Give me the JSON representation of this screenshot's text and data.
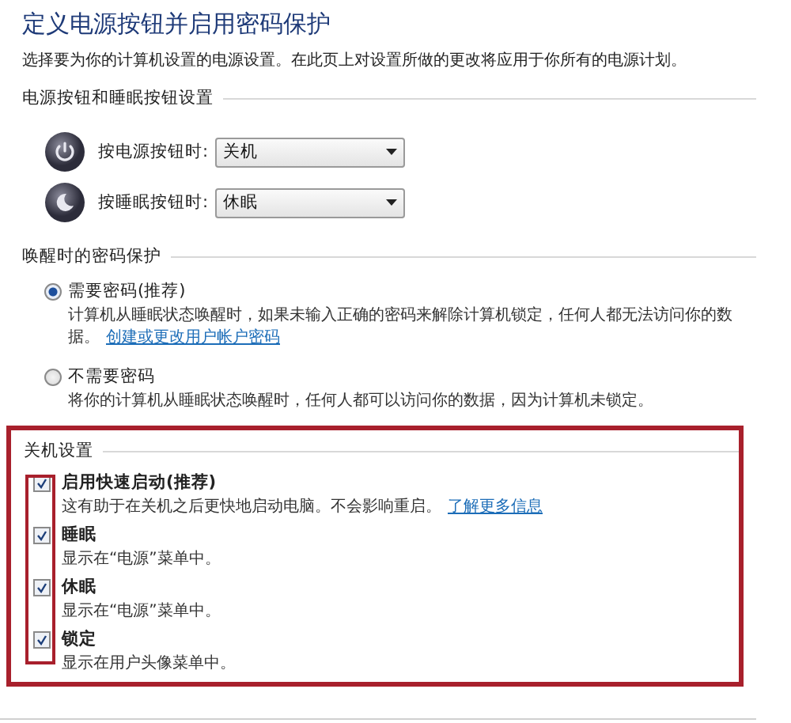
{
  "title": "定义电源按钮并启用密码保护",
  "description": "选择要为你的计算机设置的电源设置。在此页上对设置所做的更改将应用于你所有的电源计划。",
  "button_section": {
    "heading": "电源按钮和睡眠按钮设置",
    "rows": [
      {
        "kind": "power",
        "label": "按电源按钮时:",
        "value": "关机"
      },
      {
        "kind": "sleep",
        "label": "按睡眠按钮时:",
        "value": "休眠"
      }
    ]
  },
  "password_section": {
    "heading": "唤醒时的密码保护",
    "options": [
      {
        "label": "需要密码(推荐)",
        "description": "计算机从睡眠状态唤醒时，如果未输入正确的密码来解除计算机锁定，任何人都无法访问你的数据。",
        "link": "创建或更改用户帐户密码",
        "selected": true
      },
      {
        "label": "不需要密码",
        "description": "将你的计算机从睡眠状态唤醒时，任何人都可以访问你的数据，因为计算机未锁定。",
        "selected": false
      }
    ]
  },
  "shutdown_section": {
    "heading": "关机设置",
    "items": [
      {
        "label": "启用快速启动(推荐)",
        "description": "这有助于在关机之后更快地启动电脑。不会影响重启。",
        "link": "了解更多信息",
        "checked": true
      },
      {
        "label": "睡眠",
        "description": "显示在“电源”菜单中。",
        "checked": true
      },
      {
        "label": "休眠",
        "description": "显示在“电源”菜单中。",
        "checked": true
      },
      {
        "label": "锁定",
        "description": "显示在用户头像菜单中。",
        "checked": true
      }
    ]
  }
}
